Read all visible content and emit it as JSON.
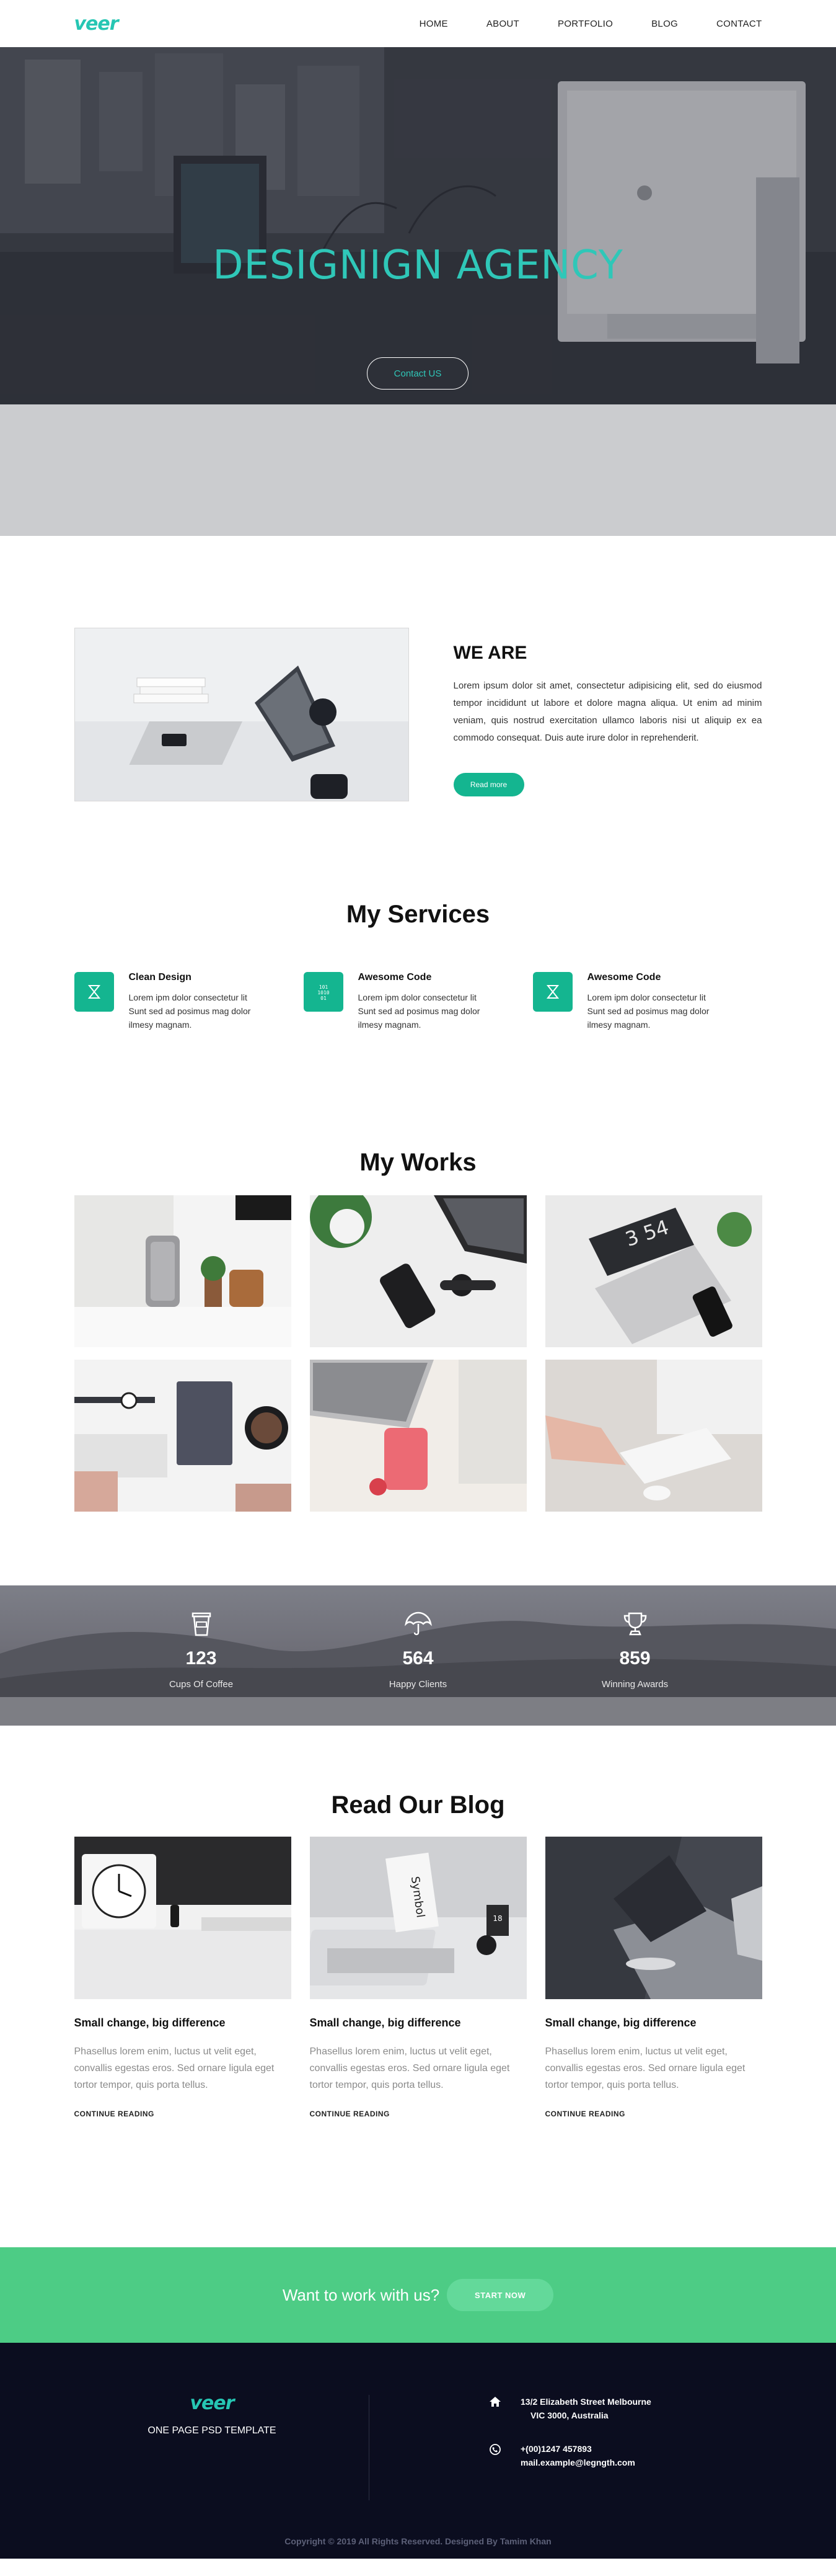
{
  "nav": {
    "logo": "veer",
    "menu": [
      "HOME",
      "ABOUT",
      "PORTFOLIO",
      "BLOG",
      "CONTACT"
    ]
  },
  "hero": {
    "title": "DESIGNIGN AGENCY",
    "button": "Contact US"
  },
  "about": {
    "title": "WE ARE",
    "text": "Lorem ipsum dolor sit amet, consectetur adipisicing elit, sed do eiusmod tempor incididunt ut labore et dolore magna aliqua. Ut enim ad minim veniam, quis nostrud exercitation ullamco laboris nisi ut aliquip ex ea commodo consequat. Duis aute irure dolor in reprehenderit.",
    "button": "Read more"
  },
  "services": {
    "title": "My Services",
    "items": [
      {
        "title": "Clean Design",
        "text": "Lorem ipm dolor consectetur lit Sunt sed ad posimus mag dolor ilmesy magnam.",
        "icon": "design-icon"
      },
      {
        "title": "Awesome Code",
        "text": "Lorem ipm dolor consectetur lit Sunt sed ad posimus mag dolor ilmesy magnam.",
        "icon": "code-icon"
      },
      {
        "title": "Awesome Code",
        "text": "Lorem ipm dolor consectetur lit Sunt sed ad posimus mag dolor ilmesy magnam.",
        "icon": "design-icon"
      }
    ]
  },
  "works": {
    "title": "My Works"
  },
  "stats": [
    {
      "value": "123",
      "label": "Cups Of Coffee",
      "icon": "coffee-cup-icon"
    },
    {
      "value": "564",
      "label": "Happy Clients",
      "icon": "umbrella-icon"
    },
    {
      "value": "859",
      "label": "Winning Awards",
      "icon": "trophy-icon"
    }
  ],
  "blog": {
    "title": "Read Our Blog",
    "posts": [
      {
        "title": "Small change, big difference",
        "text": "Phasellus lorem enim, luctus ut velit eget, convallis egestas eros. Sed ornare ligula eget tortor tempor, quis porta tellus.",
        "link": "CONTINUE READING"
      },
      {
        "title": "Small change, big difference",
        "text": "Phasellus lorem enim, luctus ut velit eget, convallis egestas eros. Sed ornare ligula eget tortor tempor, quis porta tellus.",
        "link": "CONTINUE READING"
      },
      {
        "title": "Small change, big difference",
        "text": "Phasellus lorem enim, luctus ut velit eget, convallis egestas eros. Sed ornare ligula eget tortor tempor, quis porta tellus.",
        "link": "CONTINUE READING"
      }
    ]
  },
  "cta": {
    "text": "Want to work with us?",
    "button": "START NOW"
  },
  "footer": {
    "logo": "veer",
    "tagline": "ONE PAGE PSD TEMPLATE",
    "address_line1": "13/2 Elizabeth Street Melbourne",
    "address_line2": "VIC 3000, Australia",
    "phone": "+(00)1247 457893",
    "email": "mail.example@legngth.com",
    "copyright": "Copyright © 2019 All Rights Reserved. Designed By Tamim Khan"
  },
  "colors": {
    "accent": "#26c6b3",
    "green": "#14b590",
    "cta_bg": "#4dcc85",
    "footer_bg": "#0b0d1f"
  }
}
